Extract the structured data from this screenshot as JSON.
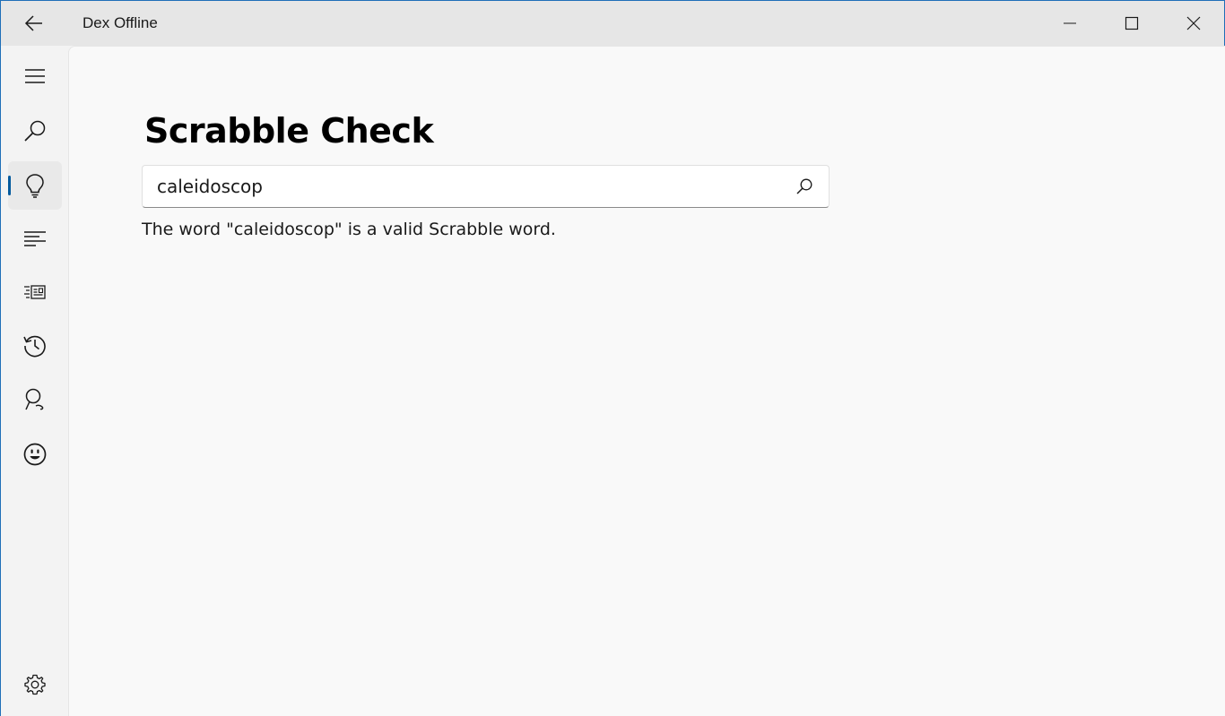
{
  "app": {
    "title": "Dex Offline"
  },
  "titlebar": {
    "back_icon": "back-arrow-icon",
    "minimize_icon": "minimize-icon",
    "maximize_icon": "maximize-icon",
    "close_icon": "close-icon"
  },
  "nav": {
    "items": [
      {
        "icon": "hamburger-menu-icon"
      },
      {
        "icon": "search-icon"
      },
      {
        "icon": "lightbulb-icon",
        "selected": true
      },
      {
        "icon": "text-lines-icon"
      },
      {
        "icon": "news-list-icon"
      },
      {
        "icon": "history-icon"
      },
      {
        "icon": "location-pin-icon"
      },
      {
        "icon": "smiley-icon"
      }
    ],
    "settings_icon": "gear-icon"
  },
  "page": {
    "title": "Scrabble Check",
    "search_value": "caleidoscop",
    "result": "The word \"caleidoscop\" is a valid Scrabble word."
  },
  "colors": {
    "accent": "#005a9e",
    "window_border": "#1f6fb8",
    "titlebar_bg": "#e6e6e6",
    "content_bg": "#f9f9f9"
  }
}
